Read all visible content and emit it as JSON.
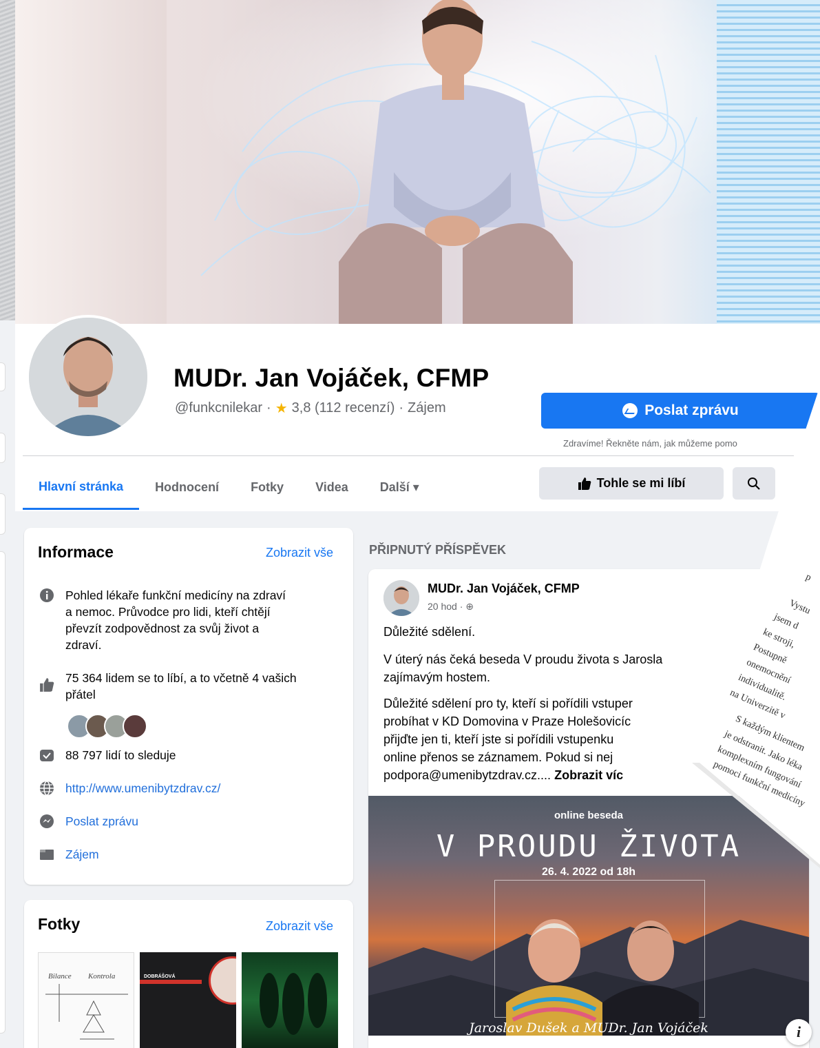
{
  "profile": {
    "name": "MUDr. Jan Vojáček, CFMP",
    "handle": "@funkcnilekar",
    "rating": "3,8 (112 recenzí)",
    "category": "Zájem",
    "separator": "·"
  },
  "actions": {
    "message_label": "Poslat zprávu",
    "greeting": "Zdravíme! Řekněte nám, jak můžeme pomo",
    "like_label": "Tohle se mi líbí"
  },
  "tabs": [
    {
      "label": "Hlavní stránka",
      "active": true
    },
    {
      "label": "Hodnocení"
    },
    {
      "label": "Fotky"
    },
    {
      "label": "Videa"
    },
    {
      "label": "Další ▾"
    }
  ],
  "info": {
    "title": "Informace",
    "see_all": "Zobrazit vše",
    "about_lines": [
      "Pohled lékaře funkční medicíny na zdraví",
      "a nemoc. Průvodce pro lidi, kteří chtějí",
      "převzít zodpovědnost za svůj život a",
      "zdraví."
    ],
    "likes_lines": [
      "75 364 lidem se to líbí, a to včetně 4 vašich",
      "přátel"
    ],
    "followers": "88 797 lidí to sleduje",
    "website": "http://www.umenibytzdrav.cz/",
    "message": "Poslat zprávu",
    "category": "Zájem"
  },
  "photos": {
    "title": "Fotky",
    "see_all": "Zobrazit vše",
    "thumb1_words": [
      "Bilance",
      "Kontrola"
    ],
    "thumb2_text": "DOBRÁŠOVÁ"
  },
  "post": {
    "pinned_label": "PŘIPNUTÝ PŘÍSPĚVEK",
    "author": "MUDr. Jan Vojáček, CFMP",
    "time": "20 hod · ",
    "lines": [
      "Důležité sdělení.",
      "V úterý nás čeká beseda V proudu života s Jarosla",
      "zajímavým hostem.",
      "Důležité sdělení pro ty, kteří si pořídili vstuper",
      "probíhat v KD Domovina v Praze Holešovicíc",
      "přijďte jen ti, kteří jste si pořídili vstupenku",
      "online přenos se záznamem. Pokud si nej",
      "podpora@umenibytzdrav.cz...."
    ],
    "see_more": "Zobrazit víc",
    "event": {
      "small": "online beseda",
      "title": "V PROUDU ŽIVOTA",
      "date": "26. 4. 2022 od 18h",
      "names": "Jaroslav Dušek a MUDr. Jan Vojáček"
    }
  },
  "overlay_doc": {
    "lines": [
      "p",
      "Vystu",
      "jsem d",
      "ke stroji,",
      "Postupně",
      "onemocnění",
      "individualitě.",
      "na Univerzitě v",
      "S každým klientem",
      "je odstranit. Jako léka",
      "komplexním fungování",
      "pomoci funkční medicíny"
    ]
  },
  "colors": {
    "accent": "#1877f2",
    "background": "#f0f2f5",
    "muted": "#65676b"
  }
}
